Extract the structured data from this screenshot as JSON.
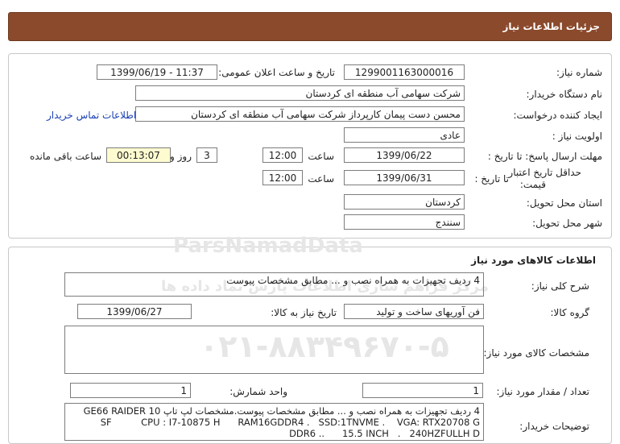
{
  "header": {
    "title": "جزئیات اطلاعات نیاز"
  },
  "info": {
    "need_number_label": "شماره نیاز:",
    "need_number": "1299001163000016",
    "announce_label": "تاریخ و ساعت اعلان عمومی:",
    "announce_value": "1399/06/19 - 11:37",
    "buyer_org_label": "نام دستگاه خریدار:",
    "buyer_org": "شرکت سهامی آب منطقه ای کردستان",
    "requester_label": "ایجاد کننده درخواست:",
    "requester": "محسن دست پیمان کارپرداز شرکت سهامی آب منطقه ای کردستان",
    "contact_link": "اطلاعات تماس خریدار",
    "priority_label": "اولویت نیاز :",
    "priority": "عادی",
    "deadline_label": "مهلت ارسال پاسخ: تا تاریخ :",
    "deadline_date": "1399/06/22",
    "time_label": "ساعت",
    "deadline_time": "12:00",
    "days_value": "3",
    "days_label": "روز و",
    "remaining_value": "00:13:07",
    "remaining_label": "ساعت باقی مانده",
    "validity_label_1": "حداقل تاریخ اعتبار",
    "validity_label_2": "قیمت:",
    "validity_to_label": "تا تاریخ :",
    "validity_date": "1399/06/31",
    "validity_time": "12:00",
    "province_label": "استان محل تحویل:",
    "province": "کردستان",
    "city_label": "شهر محل تحویل:",
    "city": "سنندج"
  },
  "goods": {
    "section_title": "اطلاعات کالاهای مورد نیاز",
    "summary_label": "شرح کلی نیاز:",
    "summary": "4 ردیف تجهیزات به همراه نصب و ... مطابق مشخصات پیوست",
    "group_label": "گروه کالا:",
    "group": "فن آوریهای ساخت و تولید",
    "need_date_label": "تاریخ نیاز به کالا:",
    "need_date": "1399/06/27",
    "specs_label": "مشخصات کالای مورد نیاز:",
    "unit_label": "واحد شمارش:",
    "unit": "1",
    "qty_label": "تعداد / مقدار مورد نیاز:",
    "qty": "1",
    "buyer_desc_label": "توضیحات خریدار:",
    "buyer_desc_line1": "4 ردیف تجهیزات به همراه نصب و ... مطابق مشخصات پیوست.مشخصات لپ تاپ GE66 RAIDER 10",
    "buyer_desc_line2": "SF          CPU : I7-10875 H      RAM16GDDR4 .   SSD:1TNVME .    VGA: RTX20708 G",
    "buyer_desc_line3": "DDR6 ..      15.5 INCH   .   240HZFULLH D"
  },
  "watermark": {
    "brand": "ParsNamadData",
    "persian": "مرکز فراهم سازی اطلاعات پارس نماد داده ها",
    "phone": "۰۲۱-۸۸۳۴۹۶۷۰-۵"
  }
}
